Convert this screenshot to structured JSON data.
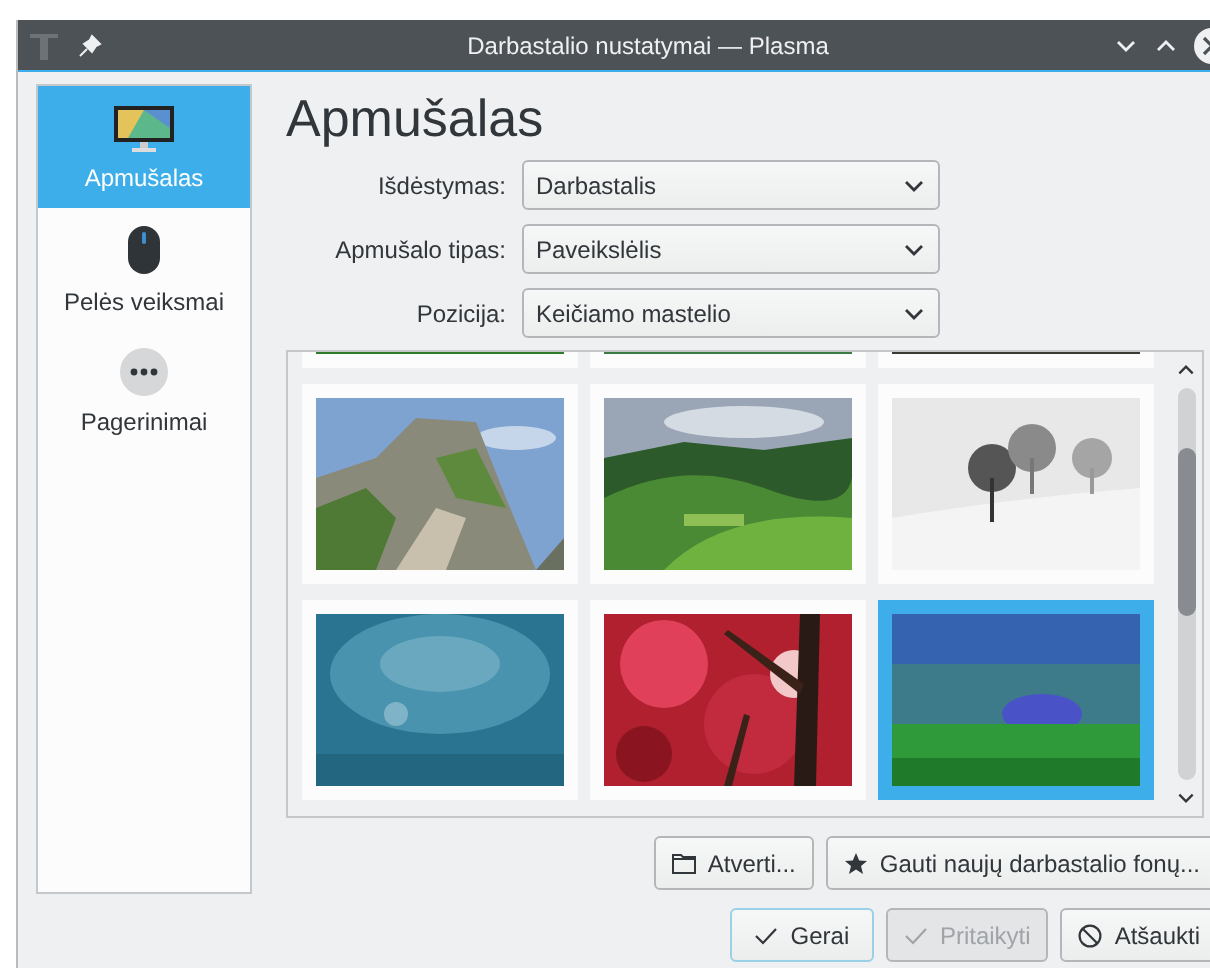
{
  "window": {
    "title": "Darbastalio nustatymai — Plasma"
  },
  "sidebar": {
    "items": [
      {
        "label": "Apmušalas",
        "selected": true,
        "kind": "monitor"
      },
      {
        "label": "Pelės veiksmai",
        "selected": false,
        "kind": "mouse"
      },
      {
        "label": "Pagerinimai",
        "selected": false,
        "kind": "more"
      }
    ]
  },
  "heading": "Apmušalas",
  "form": [
    {
      "label": "Išdėstymas:",
      "value": "Darbastalis"
    },
    {
      "label": "Apmušalo tipas:",
      "value": "Paveikslėlis"
    },
    {
      "label": "Pozicija:",
      "value": "Keičiamo mastelio"
    }
  ],
  "wallpapers": [
    {
      "kind": "picture",
      "selected": false
    },
    {
      "kind": "picture",
      "selected": false
    },
    {
      "kind": "picture",
      "selected": false
    },
    {
      "kind": "picture",
      "selected": false
    },
    {
      "kind": "picture",
      "selected": false
    },
    {
      "kind": "picture",
      "selected": false
    },
    {
      "kind": "picture",
      "selected": false
    },
    {
      "kind": "picture",
      "selected": false
    },
    {
      "kind": "picture",
      "selected": true
    }
  ],
  "buttons": [
    {
      "label": "Atverti...",
      "kind": "open"
    },
    {
      "label": "Gauti naujų darbastalio fonų...",
      "kind": "download"
    }
  ],
  "dialog_buttons": [
    {
      "label": "Gerai",
      "kind": "ok",
      "disabled": false,
      "default": true
    },
    {
      "label": "Pritaikyti",
      "kind": "apply",
      "disabled": true,
      "default": false
    },
    {
      "label": "Atšaukti",
      "kind": "cancel",
      "disabled": false,
      "default": false
    }
  ]
}
